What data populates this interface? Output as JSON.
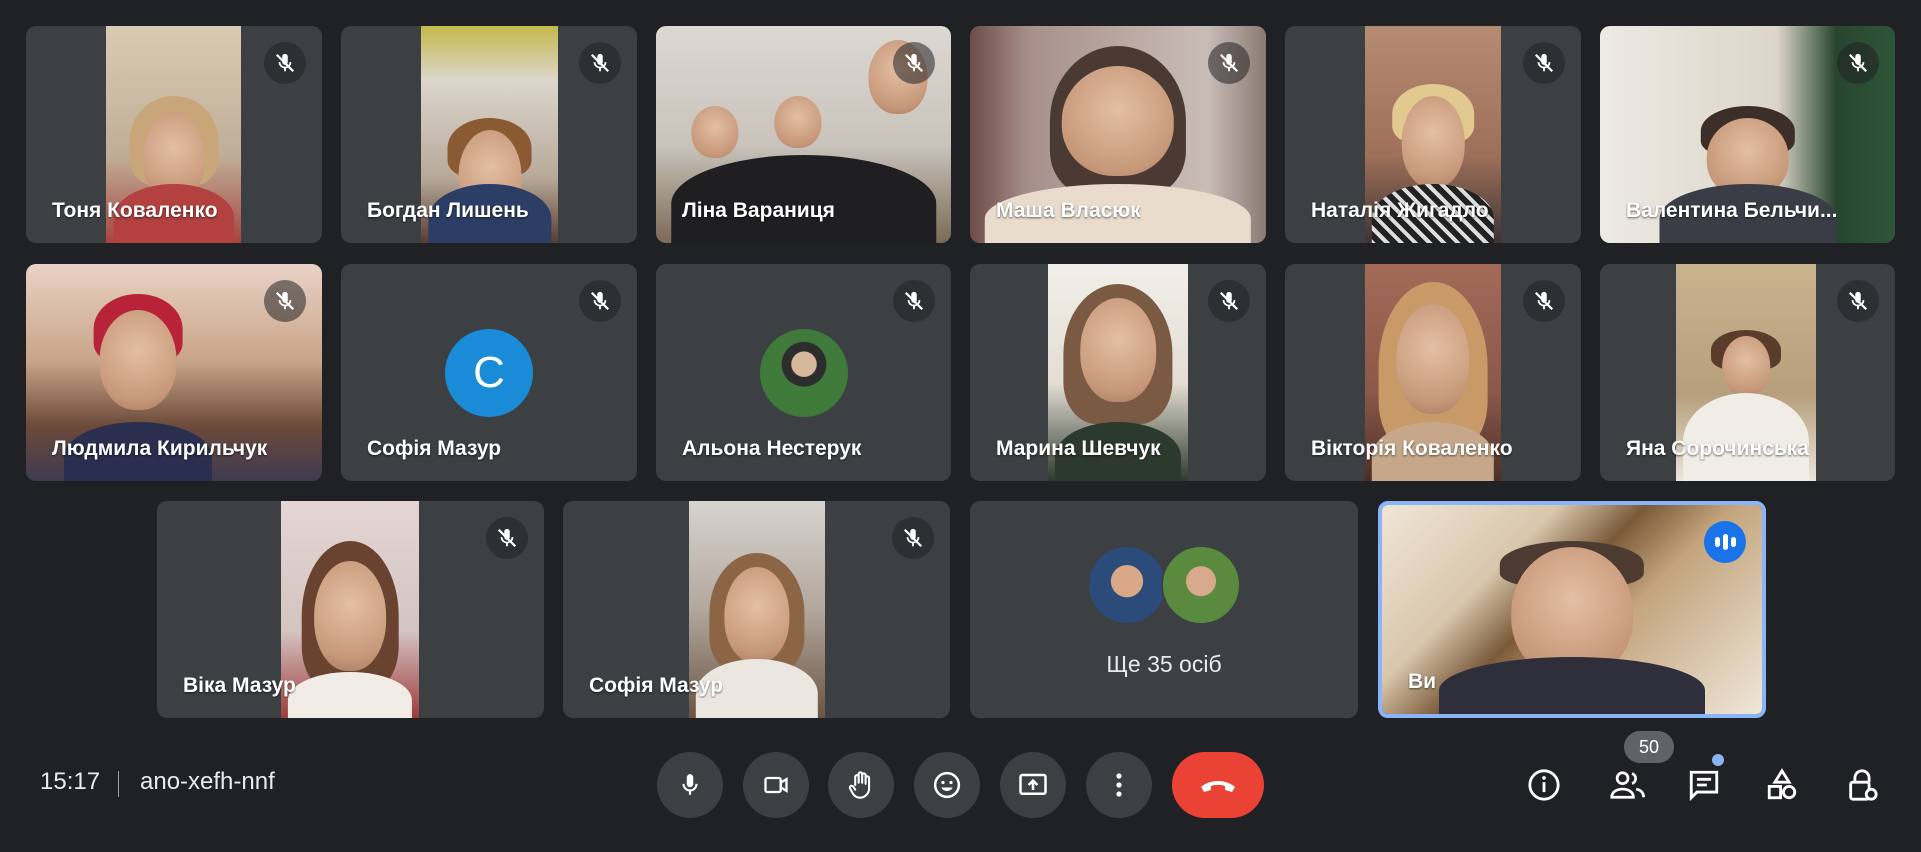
{
  "participants_row1": [
    {
      "name": "Тоня Коваленко"
    },
    {
      "name": "Богдан Лишень"
    },
    {
      "name": "Ліна Вараниця"
    },
    {
      "name": "Маша Власюк"
    },
    {
      "name": "Наталія Жигадло"
    },
    {
      "name": "Валентина Бельчи..."
    }
  ],
  "participants_row2": [
    {
      "name": "Людмила Кирильчук"
    },
    {
      "name": "Софія Мазур",
      "avatar_letter": "C"
    },
    {
      "name": "Альона Нестерук"
    },
    {
      "name": "Марина Шевчук"
    },
    {
      "name": "Вікторія Коваленко"
    },
    {
      "name": "Яна Сорочинська"
    }
  ],
  "participants_row3": [
    {
      "name": "Віка Мазур"
    },
    {
      "name": "Софія Мазур"
    }
  ],
  "more": {
    "label": "Ще 35 осіб"
  },
  "self": {
    "name": "Ви"
  },
  "meeting": {
    "time": "15:17",
    "code": "ano-xefh-nnf"
  },
  "people_count": "50",
  "icons": {
    "muted": "mic-off-icon",
    "speaking": "speaking-icon",
    "controls": [
      "microphone-icon",
      "camera-icon",
      "raise-hand-icon",
      "emoji-icon",
      "present-screen-icon",
      "more-options-icon",
      "end-call-icon"
    ],
    "right": [
      "info-icon",
      "people-icon",
      "chat-icon",
      "activities-icon",
      "host-controls-icon"
    ]
  },
  "colors": {
    "accent": "#8ab4f8",
    "end_call": "#ea4335",
    "avatar": "#1a8bd6",
    "speaking": "#1a73e8"
  }
}
